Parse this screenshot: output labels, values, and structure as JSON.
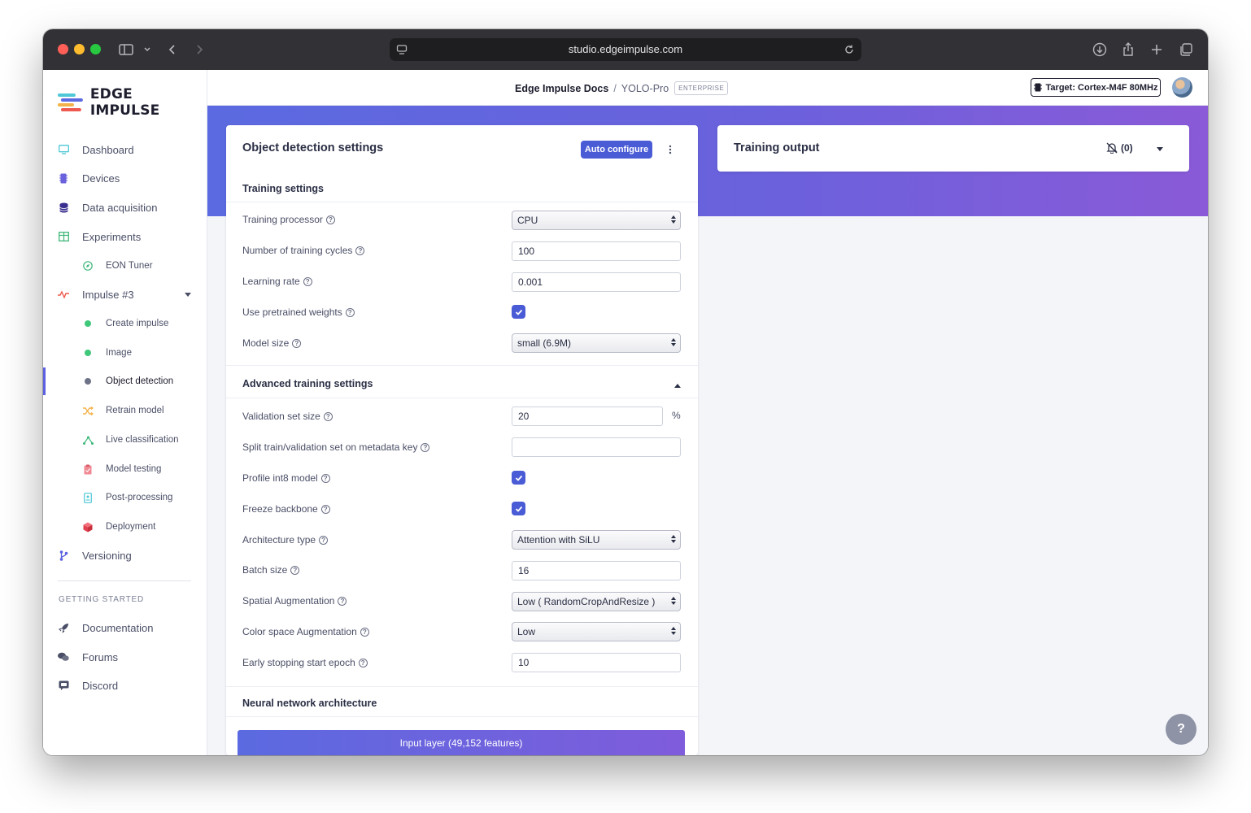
{
  "browser": {
    "url": "studio.edgeimpulse.com"
  },
  "logo": {
    "text": "EDGE IMPULSE"
  },
  "sidebar": {
    "items": [
      {
        "label": "Dashboard",
        "icon": "monitor-icon"
      },
      {
        "label": "Devices",
        "icon": "chip-icon"
      },
      {
        "label": "Data acquisition",
        "icon": "database-icon"
      },
      {
        "label": "Experiments",
        "icon": "table-icon"
      },
      {
        "label": "EON Tuner",
        "icon": "compass-icon"
      },
      {
        "label": "Impulse #3",
        "icon": "pulse-icon"
      },
      {
        "label": "Create impulse",
        "icon": "green-dot-icon"
      },
      {
        "label": "Image",
        "icon": "green-dot-icon"
      },
      {
        "label": "Object detection",
        "icon": "gray-dot-icon"
      },
      {
        "label": "Retrain model",
        "icon": "shuffle-icon"
      },
      {
        "label": "Live classification",
        "icon": "graph-icon"
      },
      {
        "label": "Model testing",
        "icon": "clipboard-icon"
      },
      {
        "label": "Post-processing",
        "icon": "document-icon"
      },
      {
        "label": "Deployment",
        "icon": "cube-icon"
      },
      {
        "label": "Versioning",
        "icon": "branch-icon"
      }
    ],
    "getting_started_heading": "GETTING STARTED",
    "getting_started": [
      {
        "label": "Documentation",
        "icon": "rocket-icon"
      },
      {
        "label": "Forums",
        "icon": "chat-icon"
      },
      {
        "label": "Discord",
        "icon": "discord-icon"
      }
    ]
  },
  "header": {
    "project": "Edge Impulse Docs",
    "separator": "/",
    "name": "YOLO-Pro",
    "badge": "ENTERPRISE",
    "target": "Target: Cortex-M4F 80MHz"
  },
  "settings": {
    "title": "Object detection settings",
    "auto_configure": "Auto configure",
    "training_heading": "Training settings",
    "training": {
      "processor": {
        "label": "Training processor",
        "value": "CPU"
      },
      "cycles": {
        "label": "Number of training cycles",
        "value": "100"
      },
      "learning_rate": {
        "label": "Learning rate",
        "value": "0.001"
      },
      "pretrained": {
        "label": "Use pretrained weights",
        "checked": true
      },
      "model_size": {
        "label": "Model size",
        "value": "small (6.9M)"
      }
    },
    "advanced_heading": "Advanced training settings",
    "advanced": {
      "validation": {
        "label": "Validation set size",
        "value": "20",
        "unit": "%"
      },
      "split": {
        "label": "Split train/validation set on metadata key",
        "value": ""
      },
      "profile_int8": {
        "label": "Profile int8 model",
        "checked": true
      },
      "freeze": {
        "label": "Freeze backbone",
        "checked": true
      },
      "architecture": {
        "label": "Architecture type",
        "value": "Attention with SiLU"
      },
      "batch": {
        "label": "Batch size",
        "value": "16"
      },
      "spatial": {
        "label": "Spatial Augmentation",
        "value": "Low ( RandomCropAndResize )"
      },
      "color": {
        "label": "Color space Augmentation",
        "value": "Low"
      },
      "early_stop": {
        "label": "Early stopping start epoch",
        "value": "10"
      }
    },
    "nn_heading": "Neural network architecture",
    "input_layer": "Input layer (49,152 features)"
  },
  "output": {
    "title": "Training output",
    "notifications": "(0)"
  },
  "help_fab": "?",
  "colors": {
    "accent": "#4a5bd6",
    "banner_start": "#5b6ae0",
    "banner_end": "#8a5ad8"
  }
}
